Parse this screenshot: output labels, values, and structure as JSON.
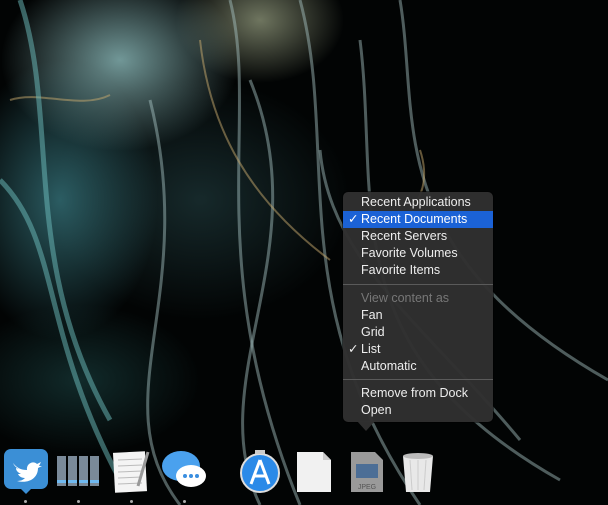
{
  "menu": {
    "items": [
      {
        "label": "Recent Applications",
        "checked": false
      },
      {
        "label": "Recent Documents",
        "checked": true,
        "highlighted": true
      },
      {
        "label": "Recent Servers",
        "checked": false
      },
      {
        "label": "Favorite Volumes",
        "checked": false
      },
      {
        "label": "Favorite Items",
        "checked": false
      }
    ],
    "view_header": "View content as",
    "view_items": [
      {
        "label": "Fan",
        "checked": false
      },
      {
        "label": "Grid",
        "checked": false
      },
      {
        "label": "List",
        "checked": true
      },
      {
        "label": "Automatic",
        "checked": false
      }
    ],
    "actions": [
      {
        "label": "Remove from Dock"
      },
      {
        "label": "Open"
      }
    ],
    "check_glyph": "✓"
  },
  "dock": {
    "apps": [
      "Twitter",
      "Server Racks",
      "TextEdit",
      "Messages",
      "App Store",
      "Document",
      "JPEG Image",
      "Trash"
    ],
    "jpeg_label": "JPEG"
  },
  "colors": {
    "highlight": "#1b62d6",
    "menu_bg": "#303030"
  }
}
